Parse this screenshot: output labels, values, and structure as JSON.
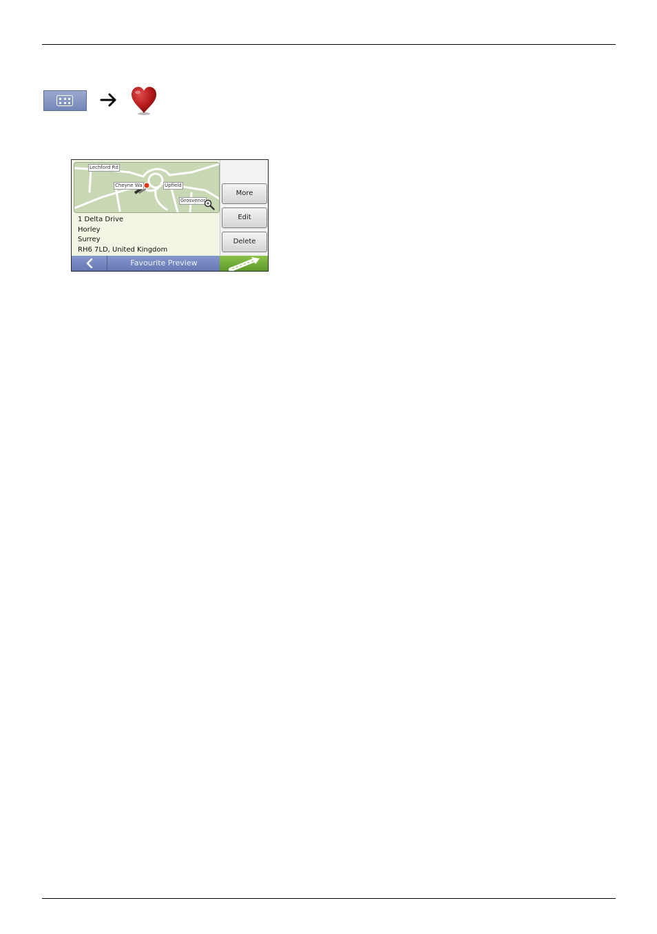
{
  "flow": {
    "menu_icon": "menu-grid-icon",
    "arrow_icon": "right-arrow-icon",
    "favourite_icon": "heart-icon"
  },
  "screen": {
    "map": {
      "labels": [
        "Lechford Rd",
        "Cheyne Wa",
        "Upfield",
        "Grosvenor"
      ],
      "zoom_icon": "magnifier-icon",
      "marker_color": "#d93a1a"
    },
    "address": [
      "1 Delta Drive",
      "Horley",
      "Surrey",
      "RH6 7LD, United Kingdom"
    ],
    "buttons": {
      "more": "More",
      "edit": "Edit",
      "delete": "Delete"
    },
    "footer": {
      "back_icon": "chevron-left-icon",
      "title": "Favourite Preview",
      "go_icon": "go-route-icon"
    }
  },
  "colors": {
    "footer_bar": "#7688c0",
    "go_button": "#6faa35",
    "heart": "#b01818"
  }
}
